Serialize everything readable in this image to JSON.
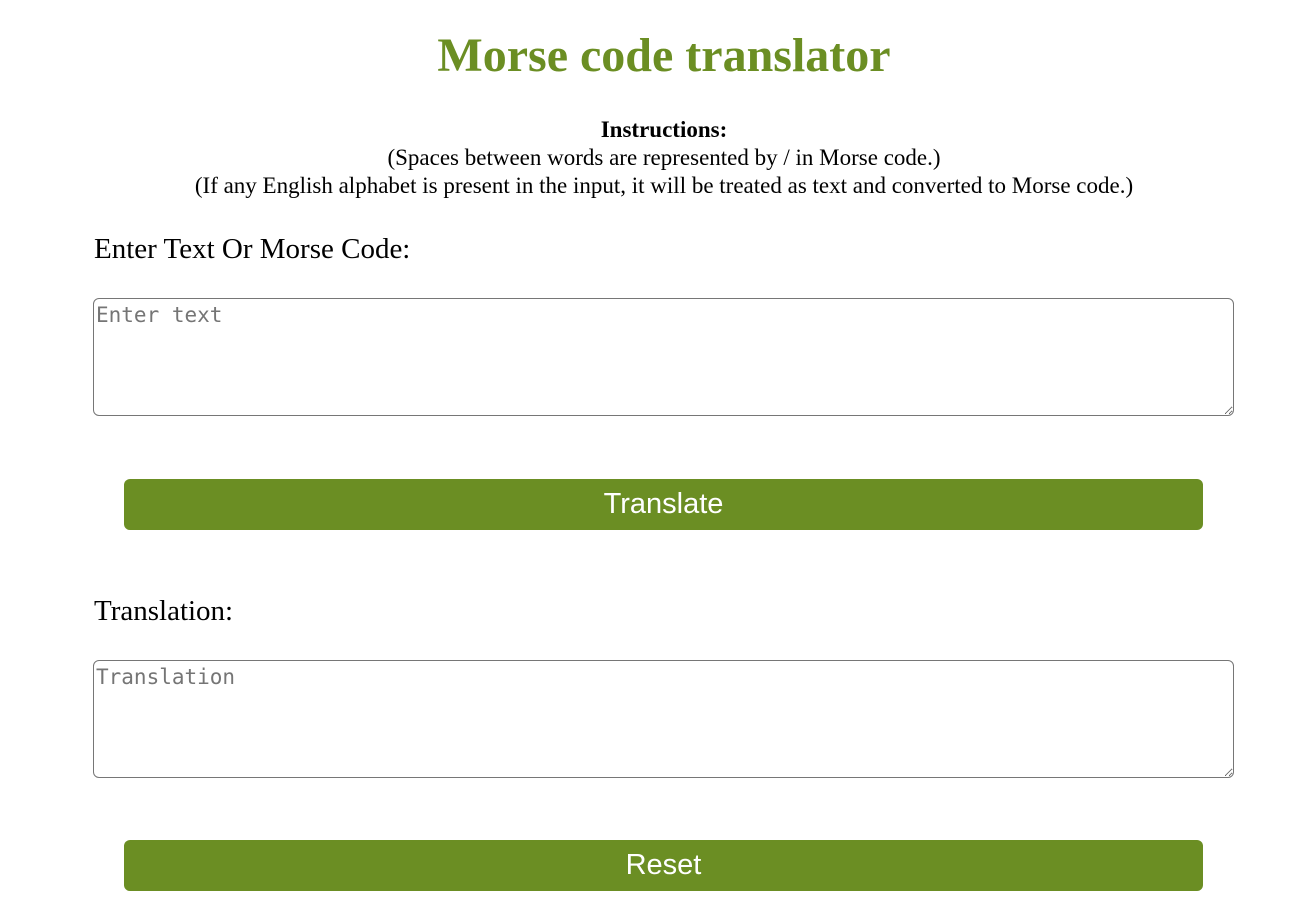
{
  "title": "Morse code translator",
  "instructions": {
    "heading": "Instructions:",
    "line1": "(Spaces between words are represented by / in Morse code.)",
    "line2": "(If any English alphabet is present in the input, it will be treated as text and converted to Morse code.)"
  },
  "input": {
    "label": "Enter Text Or Morse Code:",
    "placeholder": "Enter text",
    "value": ""
  },
  "translate_button": {
    "label": "Translate"
  },
  "output": {
    "label": "Translation:",
    "placeholder": "Translation",
    "value": ""
  },
  "reset_button": {
    "label": "Reset"
  },
  "colors": {
    "accent": "#6b8e23",
    "button_text": "#ffffff",
    "border": "#767676"
  }
}
